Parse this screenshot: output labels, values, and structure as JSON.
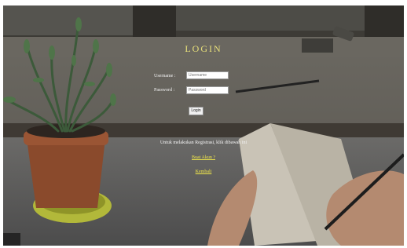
{
  "login": {
    "title": "LOGIN",
    "username_label": "Username :",
    "username_placeholder": "Username",
    "password_label": "Password :",
    "password_placeholder": "Password",
    "submit_label": "Login"
  },
  "register": {
    "info_text": "Untuk melakukan Registrasi, klik dibawah ini",
    "create_account_link": "Buat Akun ?",
    "back_link": "Kembali"
  },
  "colors": {
    "title": "#e8e07a",
    "link": "#f2e84a",
    "text": "#f4f4f4"
  }
}
